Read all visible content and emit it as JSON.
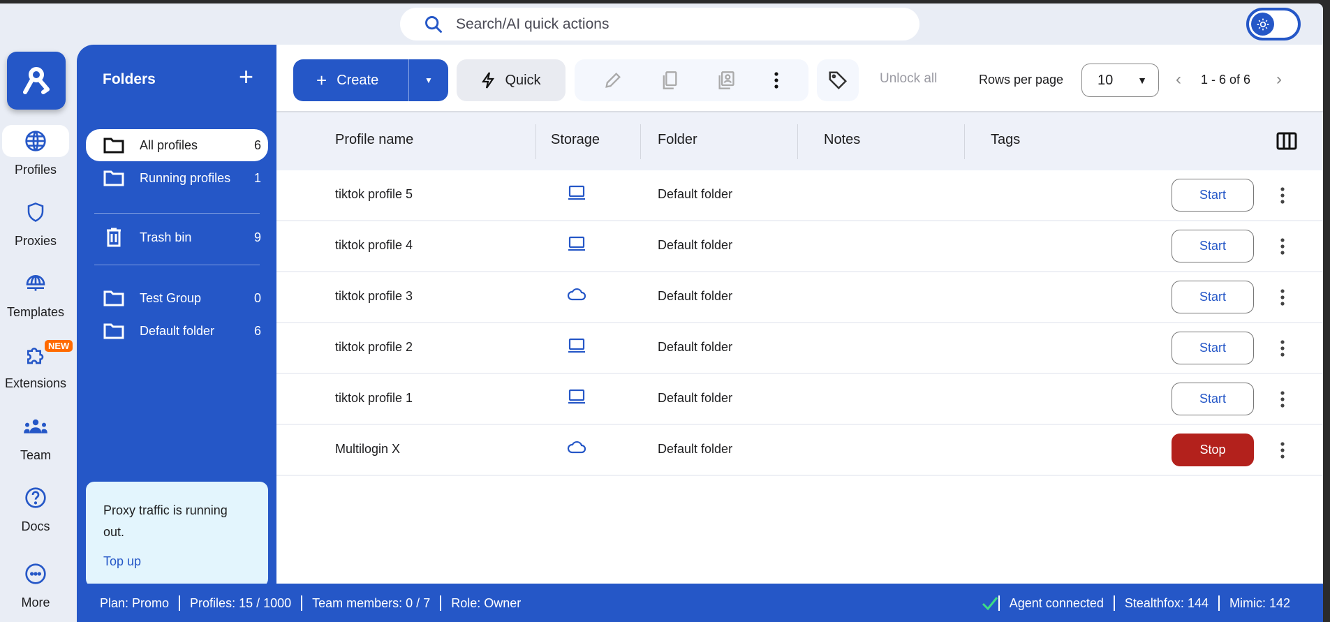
{
  "search": {
    "placeholder": "Search/AI quick actions"
  },
  "rail": {
    "items": [
      {
        "label": "Profiles"
      },
      {
        "label": "Proxies"
      },
      {
        "label": "Templates"
      },
      {
        "label": "Extensions"
      },
      {
        "label": "Team"
      },
      {
        "label": "Docs"
      },
      {
        "label": "More"
      }
    ],
    "badge": "NEW"
  },
  "folders": {
    "title": "Folders",
    "items": [
      {
        "label": "All profiles",
        "count": "6"
      },
      {
        "label": "Running profiles",
        "count": "1"
      },
      {
        "label": "Trash bin",
        "count": "9"
      },
      {
        "label": "Test Group",
        "count": "0"
      },
      {
        "label": "Default folder",
        "count": "6"
      }
    ],
    "proxy_card": {
      "text": "Proxy traffic is running out.",
      "link": "Top up"
    }
  },
  "toolbar": {
    "create": "Create",
    "quick": "Quick",
    "unlock_all": "Unlock all",
    "rows_per_page_label": "Rows per page",
    "rows_per_page": "10",
    "pagination": "1 - 6 of 6"
  },
  "table": {
    "columns": [
      "Profile name",
      "Storage",
      "Folder",
      "Notes",
      "Tags"
    ],
    "rows": [
      {
        "name": "tiktok profile 5",
        "storage": "local",
        "folder": "Default folder",
        "action": "Start"
      },
      {
        "name": "tiktok profile 4",
        "storage": "local",
        "folder": "Default folder",
        "action": "Start"
      },
      {
        "name": "tiktok profile 3",
        "storage": "cloud",
        "folder": "Default folder",
        "action": "Start"
      },
      {
        "name": "tiktok profile 2",
        "storage": "local",
        "folder": "Default folder",
        "action": "Start"
      },
      {
        "name": "tiktok profile 1",
        "storage": "local",
        "folder": "Default folder",
        "action": "Start"
      },
      {
        "name": "Multilogin X",
        "storage": "cloud",
        "folder": "Default folder",
        "action": "Stop"
      }
    ]
  },
  "footer": {
    "plan": "Plan: Promo",
    "profiles": "Profiles: 15 / 1000",
    "team": "Team members: 0 / 7",
    "role": "Role: Owner",
    "agent": "Agent connected",
    "stealthfox": "Stealthfox: 144",
    "mimic": "Mimic: 142"
  },
  "colors": {
    "brand": "#2557c7",
    "stop": "#b3211c",
    "new_badge": "#ff6a00",
    "agent_ok": "#3ddc84"
  }
}
